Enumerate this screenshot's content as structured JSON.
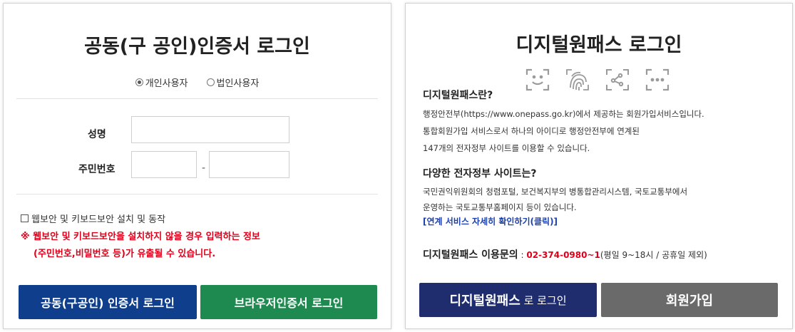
{
  "left": {
    "title": "공동(구 공인)인증서 로그인",
    "radio_individual": "개인사용자",
    "radio_corporate": "법인사용자",
    "name_label": "성명",
    "rrn_label": "주민번호",
    "rrn_dash": "-",
    "security_checkbox_label": "웹보안 및 키보드보안 설치 및 동작",
    "warning_line1": "※ 웹보안 및 키보드보안을 설치하지 않을 경우 입력하는 정보",
    "warning_line2": "(주민번호,비밀번호 등)가 유출될 수 있습니다.",
    "btn_cert_login": "공동(구공인) 인증서 로그인",
    "btn_browser_login": "브라우저인증서 로그인"
  },
  "right": {
    "title": "디지털원패스 로그인",
    "what_heading": "디지털원패스란?",
    "what_line1": "행정안전부(https://www.onepass.go.kr)에서 제공하는 회원가입서비스입니다.",
    "what_line2": "통합회원가입 서비스로서 하나의 아이디로 행정안전부에 연계된",
    "what_line3": "147개의 전자정부 사이트를 이용할 수 있습니다.",
    "sites_heading": "다양한 전자정부 사이트는?",
    "sites_line1": "국민권익위원회의 청렴포털, 보건복지부의 병통합관리시스템, 국토교통부에서",
    "sites_line2": "운영하는 국토교통부홈페이지 등이 있습니다.",
    "detail_link": "[연계 서비스 자세히 확인하기(클릭)]",
    "inquiry_label": "디지털원패스 이용문의",
    "inquiry_colon": " : ",
    "inquiry_phone": "02-374-0980~1",
    "inquiry_hours": "(평일 9~18시 / 공휴일 제외)",
    "btn_onepass_strong": "디지털원패스",
    "btn_onepass_rest": " 로 로그인",
    "btn_join": "회원가입"
  },
  "colors": {
    "navy_button": "#0f3e8c",
    "green_button": "#1e8a4f",
    "onepass_button": "#1f2d6e",
    "join_button": "#6a6a6a",
    "warning_red": "#e0001a",
    "link_blue": "#1a3fb0"
  },
  "icons": [
    "face-scan-icon",
    "fingerprint-icon",
    "pattern-icon",
    "pin-icon"
  ]
}
